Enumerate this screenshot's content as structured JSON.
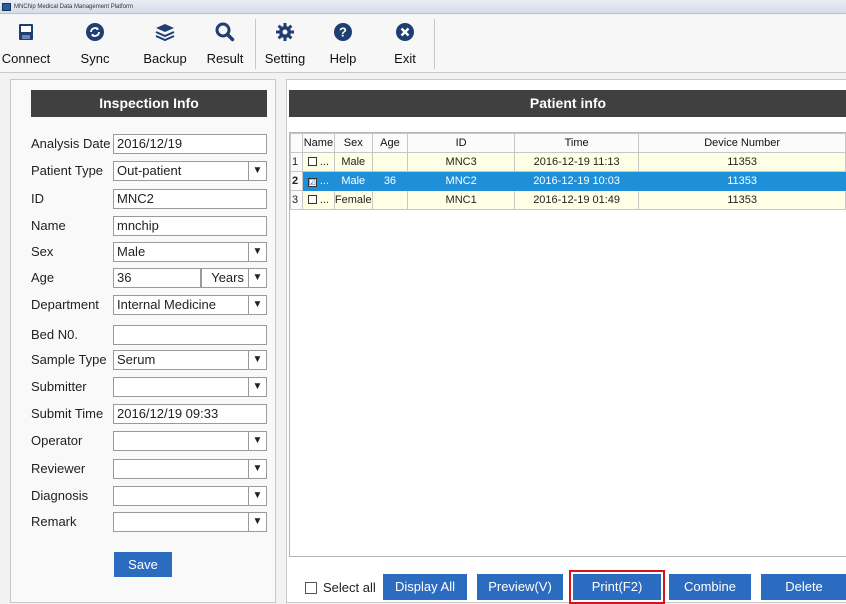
{
  "window": {
    "title": "MNChip Medical Data Management Platform"
  },
  "toolbar": {
    "connect": "Connect",
    "sync": "Sync",
    "backup": "Backup",
    "result": "Result",
    "setting": "Setting",
    "help": "Help",
    "exit": "Exit"
  },
  "inspection": {
    "title": "Inspection Info",
    "analysis_date": {
      "label": "Analysis Date",
      "value": "2016/12/19"
    },
    "patient_type": {
      "label": "Patient Type",
      "value": "Out-patient"
    },
    "id": {
      "label": "ID",
      "value": "MNC2"
    },
    "name": {
      "label": "Name",
      "value": "mnchip"
    },
    "sex": {
      "label": "Sex",
      "value": "Male"
    },
    "age": {
      "label": "Age",
      "value": "36",
      "unit": "Years"
    },
    "department": {
      "label": "Department",
      "value": "Internal Medicine"
    },
    "bed_no": {
      "label": "Bed N0.",
      "value": ""
    },
    "sample_type": {
      "label": "Sample Type",
      "value": "Serum"
    },
    "submitter": {
      "label": "Submitter",
      "value": ""
    },
    "submit_time": {
      "label": "Submit Time",
      "value": "2016/12/19 09:33"
    },
    "operator": {
      "label": "Operator",
      "value": ""
    },
    "reviewer": {
      "label": "Reviewer",
      "value": ""
    },
    "diagnosis": {
      "label": "Diagnosis",
      "value": ""
    },
    "remark": {
      "label": "Remark",
      "value": ""
    },
    "save": "Save"
  },
  "patients": {
    "title": "Patient info",
    "columns": [
      "Name",
      "Sex",
      "Age",
      "ID",
      "Time",
      "Device Number"
    ],
    "rows": [
      {
        "num": "1",
        "check": "",
        "name": "...",
        "sex": "Male",
        "age": "",
        "id": "MNC3",
        "time": "2016-12-19 11:13",
        "device": "11353"
      },
      {
        "num": "2",
        "check": "☑",
        "name": "...",
        "sex": "Male",
        "age": "36",
        "id": "MNC2",
        "time": "2016-12-19 10:03",
        "device": "11353"
      },
      {
        "num": "3",
        "check": "",
        "name": "...",
        "sex": "Female",
        "age": "",
        "id": "MNC1",
        "time": "2016-12-19 01:49",
        "device": "11353"
      }
    ],
    "select_all": "Select all",
    "buttons": {
      "display_all": "Display All",
      "preview": "Preview(V)",
      "print": "Print(F2)",
      "combine": "Combine",
      "delete": "Delete"
    }
  },
  "colors": {
    "accent": "#2b6cc1",
    "selected_row": "#1e8fd8",
    "row_bg": "#ffffe6",
    "highlight": "#d4131b",
    "header_dark": "#404040"
  }
}
